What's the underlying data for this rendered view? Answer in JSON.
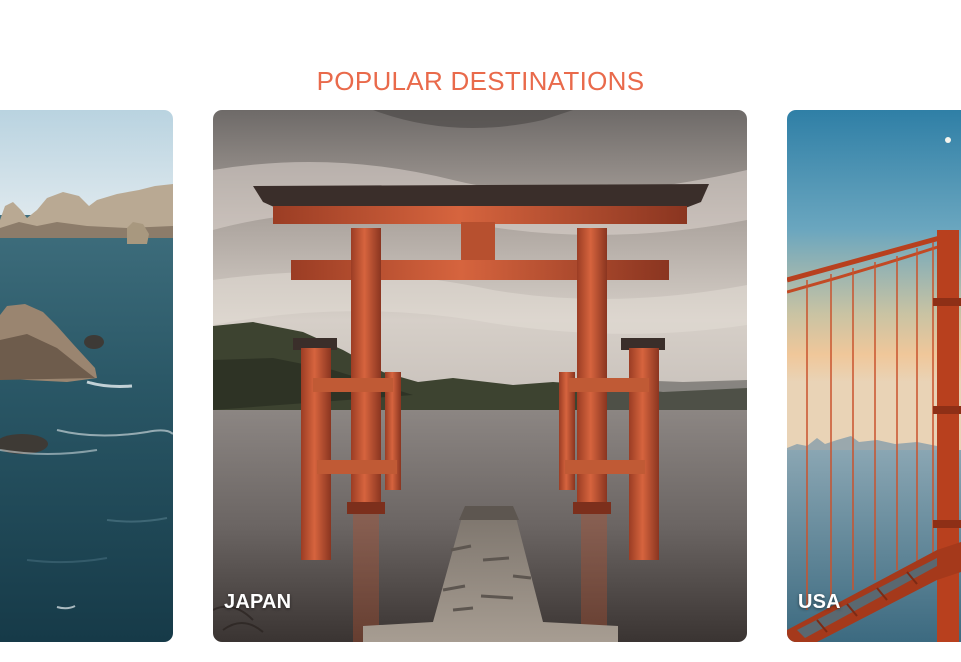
{
  "section": {
    "title": "POPULAR DESTINATIONS"
  },
  "destinations": [
    {
      "label": "",
      "image_icon": "coastal-cliffs-photo"
    },
    {
      "label": "JAPAN",
      "image_icon": "torii-gate-photo"
    },
    {
      "label": "USA",
      "image_icon": "golden-gate-bridge-photo"
    }
  ],
  "colors": {
    "accent": "#E96A4B",
    "label_text": "#FFFFFF",
    "background": "#FFFFFF"
  }
}
